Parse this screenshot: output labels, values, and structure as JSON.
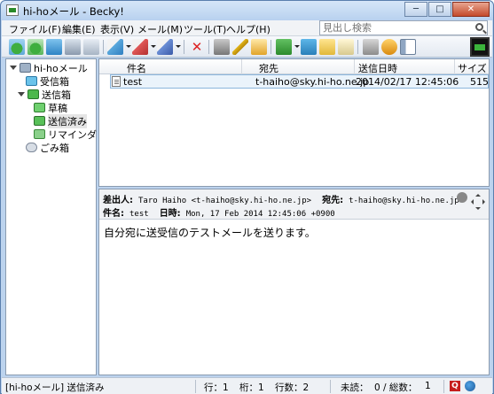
{
  "window": {
    "title": "hi-hoメール - Becky!"
  },
  "menu": {
    "items": [
      "ファイル(F)",
      "編集(E)",
      "表示(V)",
      "メール(M)",
      "ツール(T)",
      "ヘルプ(H)"
    ],
    "search_placeholder": "見出し検索"
  },
  "toolbar": {
    "icons": [
      "receive-icon",
      "receive-all-icon",
      "send-icon",
      "send-receive-icon",
      "address-book-icon",
      "new-mail-icon",
      "reply-icon",
      "forward-icon",
      "delete-icon",
      "filter-icon",
      "edit-icon",
      "compose-icon",
      "move-icon",
      "sort-icon",
      "copy-icon",
      "note-icon",
      "folder-icon",
      "settings-icon",
      "layout-icon"
    ]
  },
  "folders": [
    {
      "label": "hi-hoメール",
      "icon": "computer-icon",
      "level": 0,
      "expanded": true
    },
    {
      "label": "受信箱",
      "icon": "inbox-icon",
      "level": 1
    },
    {
      "label": "送信箱",
      "icon": "outbox-icon",
      "level": 1,
      "expanded": true
    },
    {
      "label": "草稿",
      "icon": "draft-icon",
      "level": 2
    },
    {
      "label": "送信済み",
      "icon": "sent-icon",
      "level": 2,
      "selected": true
    },
    {
      "label": "リマインダ",
      "icon": "reminder-icon",
      "level": 2
    },
    {
      "label": "ごみ箱",
      "icon": "trash-icon",
      "level": 1
    }
  ],
  "mail_list": {
    "columns": [
      "件名",
      "宛先",
      "送信日時",
      "サイズ"
    ],
    "rows": [
      {
        "subject": "test",
        "to": "t-haiho@sky.hi-ho.ne.jp",
        "date": "2014/02/17 12:45:06",
        "size": "515"
      }
    ]
  },
  "preview": {
    "from_label": "差出人:",
    "from_value": "Taro Haiho <t-haiho@sky.hi-ho.ne.jp>",
    "to_label": "宛先:",
    "to_value": "t-haiho@sky.hi-ho.ne.jp",
    "subject_label": "件名:",
    "subject_value": "test",
    "date_label": "日時:",
    "date_value": "Mon, 17 Feb 2014 12:45:06 +0900",
    "body": "自分宛に送受信のテストメールを送ります。"
  },
  "status": {
    "account_folder": "[hi-hoメール] 送信済み",
    "line": "行：1",
    "column": "桁：1",
    "lines": "行数：2",
    "unread": "未読：",
    "counts": "0 / 総数：",
    "total": "1"
  },
  "colors": {
    "accent": "#bcd3ee",
    "selection": "#eaf3fb",
    "brand_q": "#c61d1d"
  }
}
